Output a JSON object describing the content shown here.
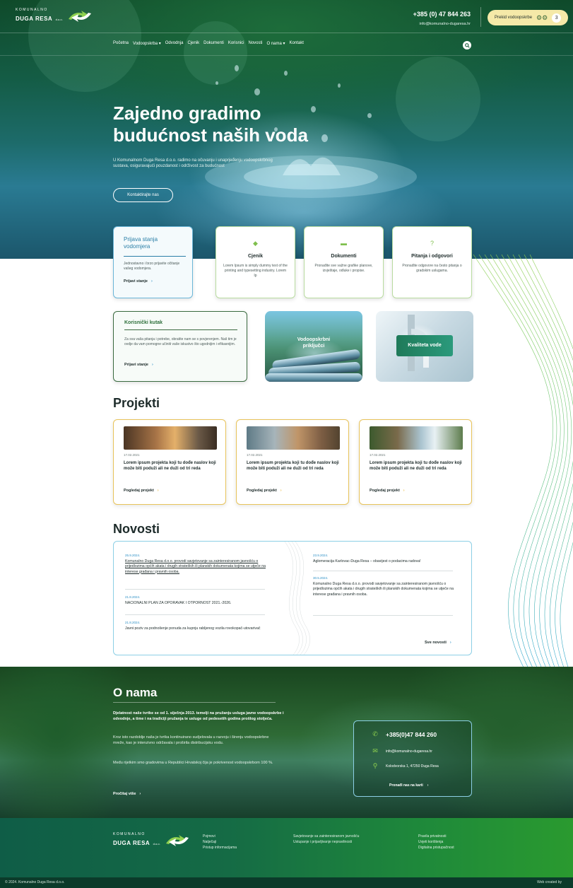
{
  "header": {
    "logo_small": "KOMUNALNO",
    "logo_big": "DUGA RESA",
    "logo_suffix": "d.o.o.",
    "phone": "+385 (0) 47 844 263",
    "email": "info@komunalno-dugaresa.hr",
    "outage_label": "Prekid vodoopskrbe",
    "outage_count": "3",
    "outage_icon": "gears-icon"
  },
  "nav": {
    "items": [
      "Početna",
      "Vodoopskrba ▾",
      "Odvodnja",
      "Cjenik",
      "Dokumenti",
      "Korisnici",
      "Novosti",
      "O nama ▾",
      "Kontakt"
    ]
  },
  "hero": {
    "title_line1": "Zajedno gradimo",
    "title_line2": "budućnost naših voda",
    "text": "U Komunalnom Duga Resa d.o.o. radimo na očuvanju i unaprjeđenju vodoopskrbnog sustava, osiguravajući pouzdanost i održivost za budućnost",
    "button": "Kontaktirajte nas"
  },
  "quick_cards": [
    {
      "title": "Prijava stanja vodomjera",
      "text": "Jednostavno i brzo prijavite očitanje vašeg vodomjera.",
      "link": "Prijavi stanje"
    },
    {
      "icon": "price-tag-icon",
      "title": "Cjenik",
      "text": "Lorem Ipsum is simply dummy text of the printing and typesetting industry. Lorem Ip"
    },
    {
      "icon": "folder-icon",
      "title": "Dokumenti",
      "text": "Pronađite sve važne grafike planove, izvještaje, odluke i propise."
    },
    {
      "icon": "question-icon",
      "title": "Pitanja i odgovori",
      "text": "Pronađite odgovore na često pitanja o gradskim uslugama."
    }
  ],
  "user_corner": {
    "title": "Korisnički kutak",
    "text": "Za sva vaša pitanja i potrebe, obratite nam se s povjerenjem. Naš tim je ovdje da vam pomogne učiniti vaše iskustvo što ugodnijim i efikasnijim.",
    "link": "Prijavi stanje"
  },
  "image_cards": [
    {
      "label": "Vodoopskrbni priključci"
    },
    {
      "label": "Kvaliteta vode"
    }
  ],
  "projects": {
    "title": "Projekti",
    "items": [
      {
        "date": "17.02.2021",
        "title": "Lorem ipsum projekta koji tu dođe naslov koji može biti poduži ali ne duži od tri reda",
        "link": "Pogledaj projekt"
      },
      {
        "date": "17.02.2021",
        "title": "Lorem ipsum projekta koji tu dođe naslov koji može biti poduži ali ne duži od tri reda",
        "link": "Pogledaj projekt"
      },
      {
        "date": "17.02.2021",
        "title": "Lorem ipsum projekta koji tu dođe naslov koji može biti poduži ali ne duži od tri reda",
        "link": "Pogledaj projekt"
      }
    ]
  },
  "news": {
    "title": "Novosti",
    "left": [
      {
        "date": "25.9.2024.",
        "title": "Komunalno Duga Resa d.o.o. provodi savjetovanje sa zainteresiranom javnošću o prijedlozima općih akata i drugih strateških ili planskih dokumenata kojima se utječe na interese građana i pravnih osoba."
      },
      {
        "date": "21.8.2024.",
        "title": "NACIONALNI PLAN ZA OPORAVAK I OTPORNOST 2021.-2026."
      },
      {
        "date": "21.8.2024.",
        "title": "Javni poziv za podnošenje ponuda za kupnju rabljenog vozila rovokopač-utovarivač"
      }
    ],
    "right": [
      {
        "date": "23.9.2024.",
        "title": "Aglomeracija Karlovac-Duga Resa – obavijest o podacima radova!"
      },
      {
        "date": "30.5.2024.",
        "title": "Komunalno Duga Resa d.o.o. provodi savjetovanje sa zainteresiranom javnošću o prijedlozima općih akata i drugih strateških ili planskih dokumenata kojima se utječe na interese građana i pravnih osoba."
      }
    ],
    "all": "Sve novosti"
  },
  "about": {
    "title": "O nama",
    "lead": "Djelatnost naše tvrtke se od 1. siječnja 2013. temelji na pružanju usluga javne vodoopskrbe i odvodnje, a time i na tradiciji pružanja te usluge od pedesetih godina prošlog stoljeća.",
    "p1": "Kroz isto razdoblje naša je tvrtka kontinuirano sudjelovala u razvoju i širenju vodoopskrbne mreže, kao je intenzivno održavala i proširila distribucijsku vodu.",
    "p2": "Među rijetkim smo gradovima u Republici Hrvatskoj čija je pokrivenost vodoopskrbom 100 %.",
    "more": "Pročitaj više"
  },
  "contact": {
    "phone": "+385(0)47 844 260",
    "email": "info@komunalno-dugaresa.hr",
    "address": "Kolodvorska 1, 47250 Duga Resa",
    "find": "Pronađi nas na karti"
  },
  "footer": {
    "col1": [
      "Pojmovi",
      "Natječaji",
      "Pristup informacijama"
    ],
    "col2": [
      "Savjetovanje sa zainteresiranom javnošću",
      "Ustupanje i prijavljivanje nepravilnosti"
    ],
    "col3": [
      "Pravila privatnosti",
      "Uvjeti korištenja",
      "Digitalna pristupačnost"
    ],
    "copyright": "© 2024. Komunalno Duga Resa d.o.o.",
    "web_by": "Web created by"
  },
  "colors": {
    "accent_green": "#7fbf4d",
    "accent_blue": "#2b8fc5",
    "project_border": "#e8c35a",
    "outage_bg": "#f5e9a8"
  }
}
